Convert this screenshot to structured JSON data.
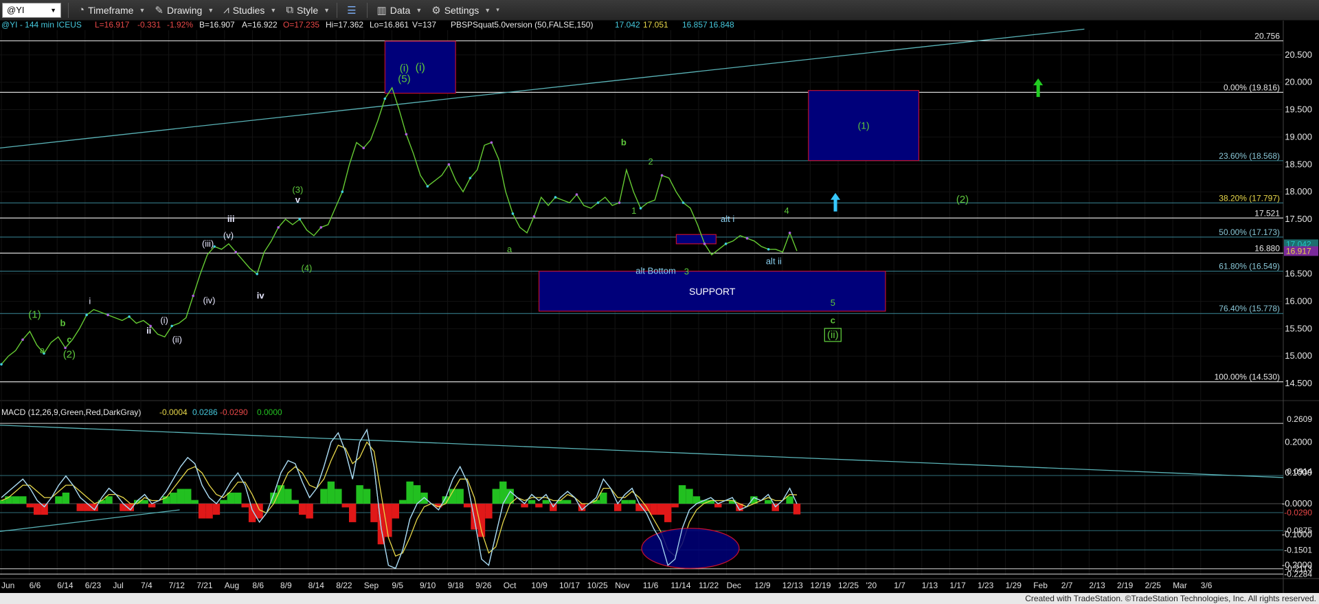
{
  "toolbar": {
    "symbol": "@YI",
    "timeframe": "Timeframe",
    "drawing": "Drawing",
    "studies": "Studies",
    "style": "Style",
    "data": "Data",
    "settings": "Settings"
  },
  "header": {
    "symbol_info": "@YI - 144 min  ICEUS",
    "last": "L=16.917",
    "change": "-0.331",
    "change_pct": "-1.92%",
    "bid": "B=16.907",
    "ask": "A=16.922",
    "open": "O=17.235",
    "high": "Hi=17.362",
    "low": "Lo=16.861",
    "volume": "V=137",
    "study": "PBSPSquat5.0version (50,FALSE,150)",
    "study_vals": [
      "17.042",
      "17.051",
      "16.857",
      "16.848"
    ]
  },
  "macd_header": {
    "title": "MACD (12,26,9,Green,Red,DarkGray)",
    "vals": [
      "-0.0004",
      "0.0286",
      "-0.0290",
      "0.0000"
    ]
  },
  "footer": "Created with TradeStation. ©TradeStation Technologies, Inc. All rights reserved.",
  "colors": {
    "background": "#000000",
    "price_line": "#66cc33",
    "macd_line": "#a8d8f0",
    "signal_line": "#e8d84a",
    "hist_pos": "#22c020",
    "hist_neg": "#e01818",
    "trend_line": "#5ab4b8",
    "box_fill": "#00007a",
    "box_border": "#c01030",
    "label_green": "#5ec83c",
    "label_white": "#e8e8ff",
    "label_cyan": "#8ad0f0",
    "arrow_cyan": "#37c8ff",
    "arrow_green": "#22cc22"
  },
  "chart_data": [
    {
      "type": "line",
      "title": "@YI - 144 min",
      "y_axis": {
        "range": [
          14.35,
          20.95
        ],
        "ticks": [
          "20.500",
          "20.000",
          "19.500",
          "19.000",
          "18.500",
          "18.000",
          "17.500",
          "16.500",
          "16.000",
          "15.500",
          "15.000",
          "14.500"
        ]
      },
      "x_labels": [
        "Jun",
        "6/6",
        "6/14",
        "6/23",
        "Jul",
        "7/4",
        "7/12",
        "7/21",
        "Aug",
        "8/6",
        "8/9",
        "8/14",
        "8/22",
        "Sep",
        "9/5",
        "9/10",
        "9/18",
        "9/26",
        "Oct",
        "10/9",
        "10/17",
        "10/25",
        "Nov",
        "11/6",
        "11/14",
        "11/22",
        "Dec",
        "12/9",
        "12/13",
        "12/19",
        "12/25",
        "'20",
        "1/7",
        "1/13",
        "1/17",
        "1/23",
        "1/29",
        "Feb",
        "2/7",
        "2/13",
        "2/19",
        "2/25",
        "Mar",
        "3/6"
      ],
      "series": [
        {
          "values": [
            14.85,
            15.0,
            15.1,
            15.3,
            15.45,
            15.2,
            15.05,
            15.25,
            15.35,
            15.15,
            15.3,
            15.5,
            15.75,
            15.85,
            15.8,
            15.75,
            15.7,
            15.65,
            15.72,
            15.6,
            15.65,
            15.55,
            15.4,
            15.35,
            15.55,
            15.6,
            15.7,
            16.1,
            16.5,
            16.85,
            17.0,
            16.95,
            17.05,
            16.9,
            16.75,
            16.6,
            16.5,
            16.9,
            17.1,
            17.35,
            17.5,
            17.4,
            17.5,
            17.3,
            17.2,
            17.35,
            17.4,
            17.7,
            18.0,
            18.5,
            18.9,
            18.8,
            18.95,
            19.3,
            19.7,
            19.9,
            19.5,
            19.05,
            18.7,
            18.3,
            18.1,
            18.2,
            18.3,
            18.5,
            18.2,
            18.0,
            18.25,
            18.4,
            18.85,
            18.9,
            18.6,
            18.0,
            17.6,
            17.35,
            17.25,
            17.55,
            17.9,
            17.75,
            17.9,
            17.85,
            17.8,
            17.95,
            17.75,
            17.7,
            17.8,
            17.9,
            17.75,
            17.8,
            18.4,
            18.0,
            17.7,
            17.8,
            17.85,
            18.3,
            18.25,
            18.0,
            17.8,
            17.7,
            17.4,
            17.05,
            16.85,
            16.95,
            17.05,
            17.1,
            17.2,
            17.15,
            17.1,
            17.0,
            16.95,
            16.95,
            16.9,
            17.25,
            16.92
          ]
        }
      ],
      "horizontal_levels": [
        {
          "value": 20.756,
          "label": "20.756"
        },
        {
          "value": 19.816,
          "label": "0.00% (19.816)"
        },
        {
          "value": 18.568,
          "label": "23.60% (18.568)"
        },
        {
          "value": 17.797,
          "label": "38.20% (17.797)"
        },
        {
          "value": 17.521,
          "label": "17.521"
        },
        {
          "value": 17.173,
          "label": "50.00% (17.173)"
        },
        {
          "value": 16.88,
          "label": "16.880"
        },
        {
          "value": 16.549,
          "label": "61.80% (16.549)"
        },
        {
          "value": 15.778,
          "label": "76.40% (15.778)"
        },
        {
          "value": 14.53,
          "label": "100.00% (14.530)"
        }
      ],
      "price_tags": [
        "17.042",
        "16.917"
      ],
      "boxes": [
        {
          "label": "(i)",
          "x0": 0.3,
          "x1": 0.355,
          "y0": 19.8,
          "y1": 20.75
        },
        {
          "label": "(1)",
          "x0": 0.63,
          "x1": 0.716,
          "y0": 18.57,
          "y1": 19.85
        },
        {
          "label": "SUPPORT",
          "x0": 0.42,
          "x1": 0.69,
          "y0": 15.82,
          "y1": 16.55
        },
        {
          "label": "",
          "x0": 0.527,
          "x1": 0.558,
          "y0": 17.05,
          "y1": 17.22
        }
      ],
      "annotations": [
        {
          "text": "(1)",
          "x": 0.027,
          "y": 15.7
        },
        {
          "text": "a",
          "x": 0.033,
          "y": 15.05
        },
        {
          "text": "b",
          "x": 0.049,
          "y": 15.55
        },
        {
          "text": "c",
          "x": 0.054,
          "y": 15.25
        },
        {
          "text": "(2)",
          "x": 0.054,
          "y": 14.97
        },
        {
          "text": "i",
          "x": 0.07,
          "y": 15.95
        },
        {
          "text": "ii",
          "x": 0.116,
          "y": 15.41
        },
        {
          "text": "(i)",
          "x": 0.128,
          "y": 15.6
        },
        {
          "text": "(ii)",
          "x": 0.138,
          "y": 15.25
        },
        {
          "text": "(iii)",
          "x": 0.162,
          "y": 17.0
        },
        {
          "text": "(iv)",
          "x": 0.163,
          "y": 15.96
        },
        {
          "text": "(v)",
          "x": 0.178,
          "y": 17.15
        },
        {
          "text": "iii",
          "x": 0.18,
          "y": 17.45
        },
        {
          "text": "iv",
          "x": 0.203,
          "y": 16.05
        },
        {
          "text": "(3)",
          "x": 0.232,
          "y": 17.98
        },
        {
          "text": "v",
          "x": 0.232,
          "y": 17.8
        },
        {
          "text": "(4)",
          "x": 0.239,
          "y": 16.55
        },
        {
          "text": "(i)",
          "x": 0.315,
          "y": 20.2
        },
        {
          "text": "(5)",
          "x": 0.315,
          "y": 20.0
        },
        {
          "text": "a",
          "x": 0.397,
          "y": 16.9
        },
        {
          "text": "b",
          "x": 0.486,
          "y": 18.85
        },
        {
          "text": "2",
          "x": 0.507,
          "y": 18.5
        },
        {
          "text": "1",
          "x": 0.494,
          "y": 17.6
        },
        {
          "text": "alt i",
          "x": 0.567,
          "y": 17.45
        },
        {
          "text": "4",
          "x": 0.613,
          "y": 17.6
        },
        {
          "text": "alt Bottom",
          "x": 0.511,
          "y": 16.5
        },
        {
          "text": "3",
          "x": 0.535,
          "y": 16.49
        },
        {
          "text": "alt ii",
          "x": 0.603,
          "y": 16.68
        },
        {
          "text": "5",
          "x": 0.649,
          "y": 15.92
        },
        {
          "text": "c",
          "x": 0.649,
          "y": 15.6
        },
        {
          "text": "(ii)",
          "x": 0.649,
          "y": 15.33
        },
        {
          "text": "(2)",
          "x": 0.75,
          "y": 17.8
        }
      ]
    },
    {
      "type": "line",
      "title": "MACD (12,26,9,Green,Red,DarkGray)",
      "y_axis": {
        "range": [
          -0.232,
          0.27
        ],
        "ticks": [
          "0.2000",
          "0.1000",
          "-0.0000",
          "-0.1000",
          "-0.2000"
        ]
      },
      "horizontal_levels": [
        {
          "value": 0.2609,
          "label": "0.2609"
        },
        {
          "value": 0.0914,
          "label": "0.0914"
        },
        {
          "value": -0.029,
          "label": "-0.0290"
        },
        {
          "value": -0.0875,
          "label": "-0.0875"
        },
        {
          "value": -0.1501,
          "label": "-0.1501"
        },
        {
          "value": -0.2113,
          "label": "-0.2113"
        },
        {
          "value": -0.2284,
          "label": "-0.2284"
        }
      ],
      "series": [
        {
          "name": "MACD",
          "values": [
            0.02,
            0.04,
            0.06,
            0.08,
            0.05,
            0.01,
            -0.01,
            0.02,
            0.06,
            0.09,
            0.06,
            0.02,
            0.0,
            -0.02,
            0.02,
            0.05,
            0.03,
            0.0,
            -0.02,
            0.01,
            0.03,
            0.0,
            0.01,
            0.04,
            0.08,
            0.12,
            0.15,
            0.13,
            0.06,
            0.02,
            0.0,
            0.03,
            0.07,
            0.1,
            0.06,
            -0.02,
            -0.06,
            -0.03,
            0.03,
            0.1,
            0.14,
            0.13,
            0.07,
            0.02,
            0.05,
            0.12,
            0.2,
            0.23,
            0.17,
            0.08,
            0.2,
            0.24,
            0.12,
            -0.08,
            -0.2,
            -0.21,
            -0.15,
            -0.05,
            0.0,
            0.02,
            0.0,
            -0.02,
            0.02,
            0.08,
            0.12,
            0.07,
            -0.05,
            -0.18,
            -0.2,
            -0.1,
            0.0,
            0.04,
            0.02,
            0.0,
            0.03,
            0.01,
            0.03,
            -0.01,
            0.02,
            0.04,
            0.02,
            -0.02,
            0.0,
            0.02,
            0.08,
            0.05,
            0.0,
            0.03,
            0.05,
            0.0,
            -0.03,
            -0.08,
            -0.12,
            -0.2,
            -0.18,
            -0.08,
            -0.02,
            0.0,
            0.01,
            0.02,
            0.0,
            0.01,
            0.02,
            -0.02,
            -0.01,
            0.02,
            0.01,
            0.03,
            -0.01,
            0.01,
            0.05,
            -0.0004
          ]
        },
        {
          "name": "Signal",
          "values": [
            0.01,
            0.02,
            0.04,
            0.06,
            0.06,
            0.04,
            0.02,
            0.02,
            0.04,
            0.06,
            0.06,
            0.04,
            0.02,
            0.0,
            0.01,
            0.03,
            0.03,
            0.02,
            0.0,
            0.0,
            0.02,
            0.01,
            0.01,
            0.02,
            0.05,
            0.08,
            0.11,
            0.12,
            0.1,
            0.06,
            0.03,
            0.02,
            0.04,
            0.07,
            0.07,
            0.03,
            -0.02,
            -0.03,
            0.0,
            0.05,
            0.1,
            0.12,
            0.1,
            0.06,
            0.05,
            0.08,
            0.14,
            0.19,
            0.18,
            0.13,
            0.15,
            0.2,
            0.17,
            0.03,
            -0.11,
            -0.17,
            -0.16,
            -0.11,
            -0.05,
            -0.01,
            0.0,
            -0.01,
            0.0,
            0.04,
            0.08,
            0.08,
            0.02,
            -0.09,
            -0.16,
            -0.14,
            -0.06,
            0.0,
            0.02,
            0.01,
            0.02,
            0.02,
            0.02,
            0.01,
            0.01,
            0.03,
            0.02,
            0.0,
            0.0,
            0.01,
            0.05,
            0.05,
            0.02,
            0.02,
            0.04,
            0.02,
            -0.01,
            -0.05,
            -0.09,
            -0.15,
            -0.17,
            -0.13,
            -0.06,
            -0.02,
            0.0,
            0.01,
            0.01,
            0.01,
            0.01,
            0.0,
            -0.01,
            0.0,
            0.01,
            0.02,
            0.01,
            0.01,
            0.03,
            0.0286
          ]
        }
      ],
      "trend_lines": [
        {
          "from": [
            0.0,
            0.255
          ],
          "to": [
            1.0,
            0.085
          ]
        },
        {
          "from": [
            0.0,
            -0.09
          ],
          "to": [
            0.14,
            -0.02
          ]
        }
      ],
      "ellipse": {
        "cx": 0.538,
        "cy": -0.145,
        "rx": 0.038,
        "ry": 0.065
      }
    }
  ]
}
